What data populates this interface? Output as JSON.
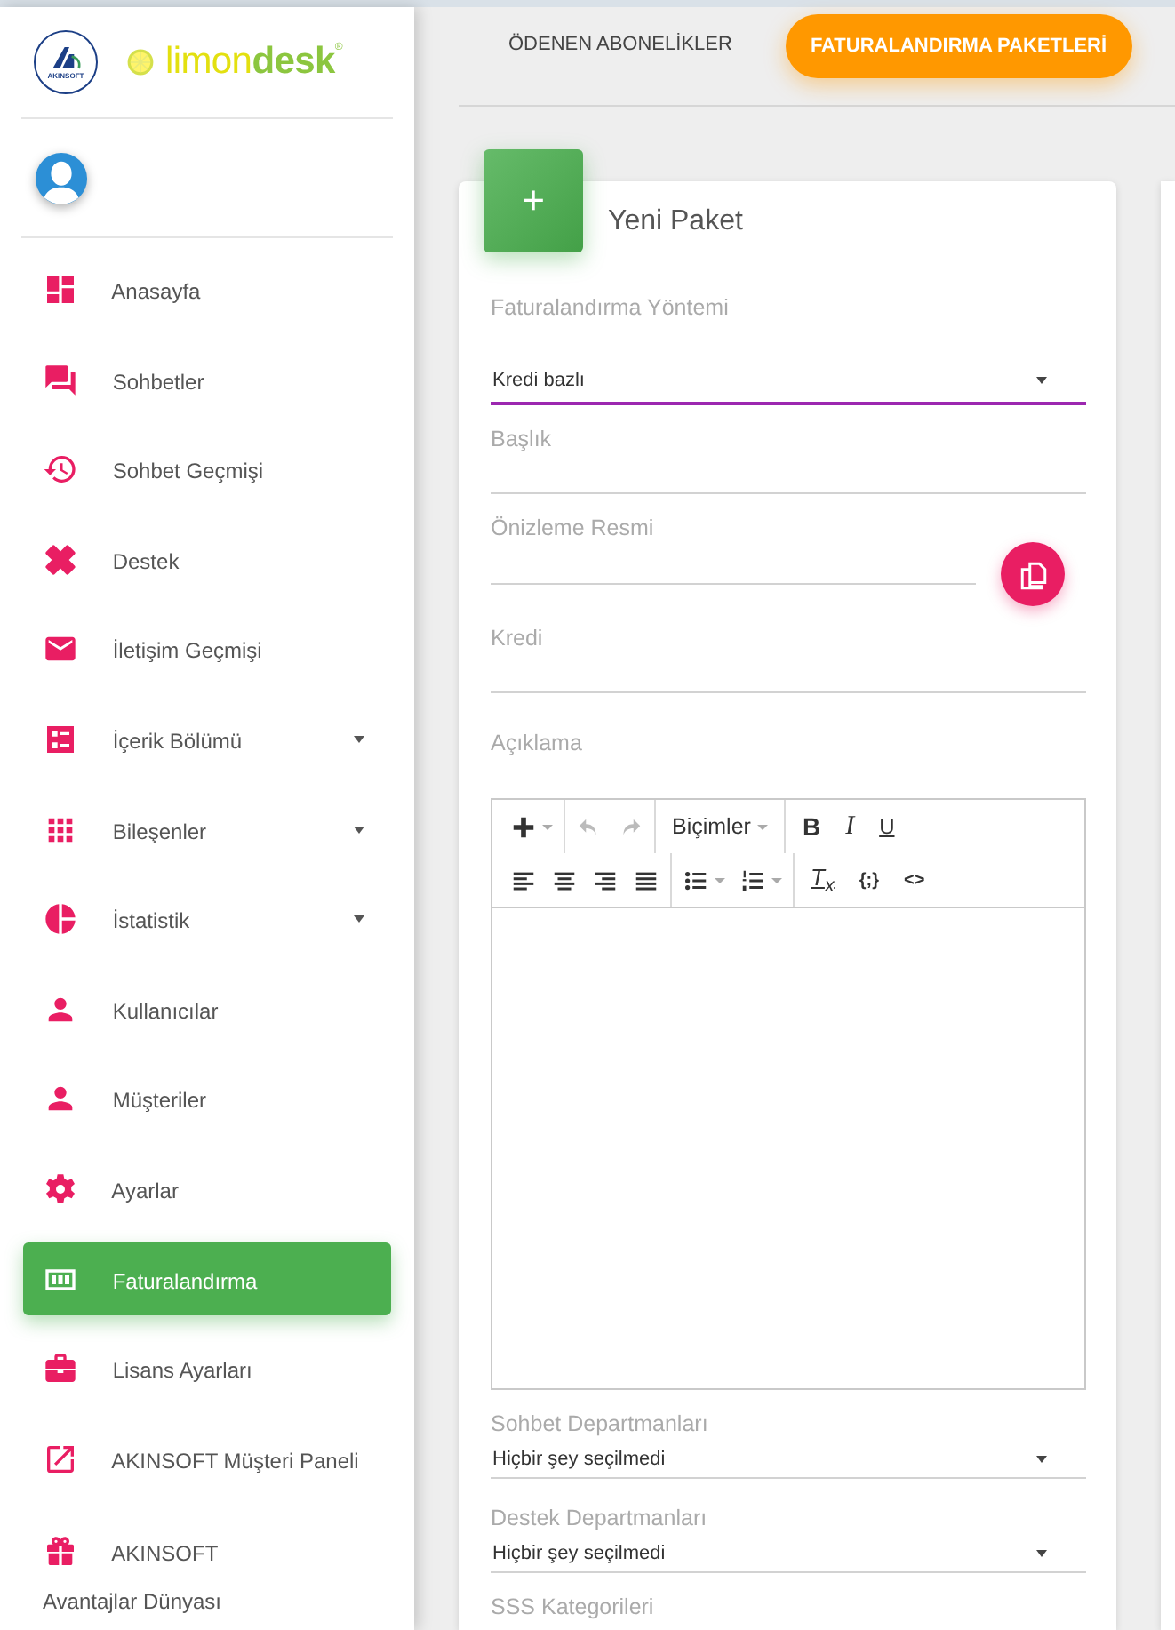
{
  "logo": {
    "emblem_text": "AKINSOFT",
    "brand_part1": "limon",
    "brand_part2": "desk",
    "registered": "®"
  },
  "sidebar": {
    "items": [
      {
        "label": "Anasayfa",
        "expandable": false,
        "selected": false
      },
      {
        "label": "Sohbetler",
        "expandable": false,
        "selected": false
      },
      {
        "label": "Sohbet Geçmişi",
        "expandable": false,
        "selected": false
      },
      {
        "label": "Destek",
        "expandable": false,
        "selected": false
      },
      {
        "label": "İletişim Geçmişi",
        "expandable": false,
        "selected": false
      },
      {
        "label": "İçerik Bölümü",
        "expandable": true,
        "selected": false
      },
      {
        "label": "Bileşenler",
        "expandable": true,
        "selected": false
      },
      {
        "label": "İstatistik",
        "expandable": true,
        "selected": false
      },
      {
        "label": "Kullanıcılar",
        "expandable": false,
        "selected": false
      },
      {
        "label": "Müşteriler",
        "expandable": false,
        "selected": false
      },
      {
        "label": "Ayarlar",
        "expandable": false,
        "selected": false
      },
      {
        "label": "Faturalandırma",
        "expandable": false,
        "selected": true
      },
      {
        "label": "Lisans Ayarları",
        "expandable": false,
        "selected": false
      },
      {
        "label": "AKINSOFT Müşteri Paneli",
        "expandable": false,
        "selected": false
      },
      {
        "label": "AKINSOFT Avantajlar Dünyası",
        "expandable": false,
        "selected": false
      }
    ]
  },
  "tabs": [
    {
      "label": "ÖDENEN ABONELİKLER",
      "selected": false
    },
    {
      "label": "FATURALANDIRMA PAKETLERİ",
      "selected": true
    }
  ],
  "card": {
    "add_button": "+",
    "title": "Yeni Paket",
    "fields": [
      {
        "kind": "select",
        "label": "Faturalandırma Yöntemi",
        "value": "Kredi bazlı",
        "focused": true
      },
      {
        "kind": "input",
        "label": "Başlık"
      },
      {
        "kind": "upload",
        "label": "Önizleme Resmi"
      },
      {
        "kind": "input",
        "label": "Kredi"
      },
      {
        "kind": "editor",
        "label": "Açıklama",
        "toolbar": {
          "format_menu": "Biçimler",
          "bold": "B",
          "italic": "I",
          "underline": "U",
          "clear_format": "T$_{x}$",
          "code_sample": "{;}",
          "source": "<>"
        }
      },
      {
        "kind": "select",
        "label": "Sohbet Departmanları",
        "value": "Hiçbir şey seçilmedi",
        "focused": false
      },
      {
        "kind": "select",
        "label": "Destek Departmanları",
        "value": "Hiçbir şey seçilmedi",
        "focused": false
      },
      {
        "kind": "label",
        "label": "SSS Kategorileri"
      }
    ]
  }
}
